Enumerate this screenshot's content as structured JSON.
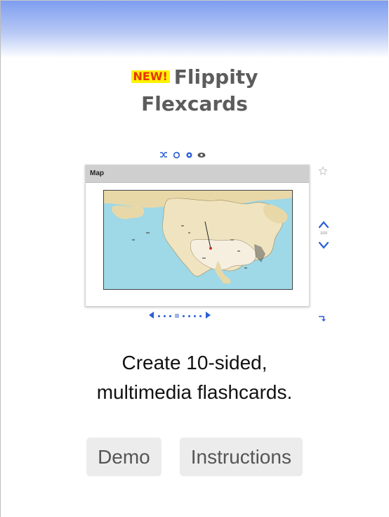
{
  "badge": {
    "label": "NEW!"
  },
  "title": {
    "line1": "Flippity",
    "line2": "Flexcards"
  },
  "preview": {
    "window_title": "Map",
    "counter": "1/10",
    "icons": [
      "shuffle-icon",
      "refresh-icon",
      "gear-icon",
      "eye-icon",
      "star-icon",
      "chevron-up-icon",
      "chevron-down-icon",
      "arrow-left-icon",
      "arrow-right-icon",
      "corner-arrow-icon"
    ]
  },
  "description": {
    "line1": "Create 10-sided,",
    "line2": "multimedia flashcards."
  },
  "buttons": {
    "demo": "Demo",
    "instructions": "Instructions"
  },
  "colors": {
    "accent": "#2b5fd6",
    "badge_bg": "#fff200",
    "badge_text": "#e8320a",
    "button_bg": "#ececec",
    "title": "#5c5c5c"
  }
}
